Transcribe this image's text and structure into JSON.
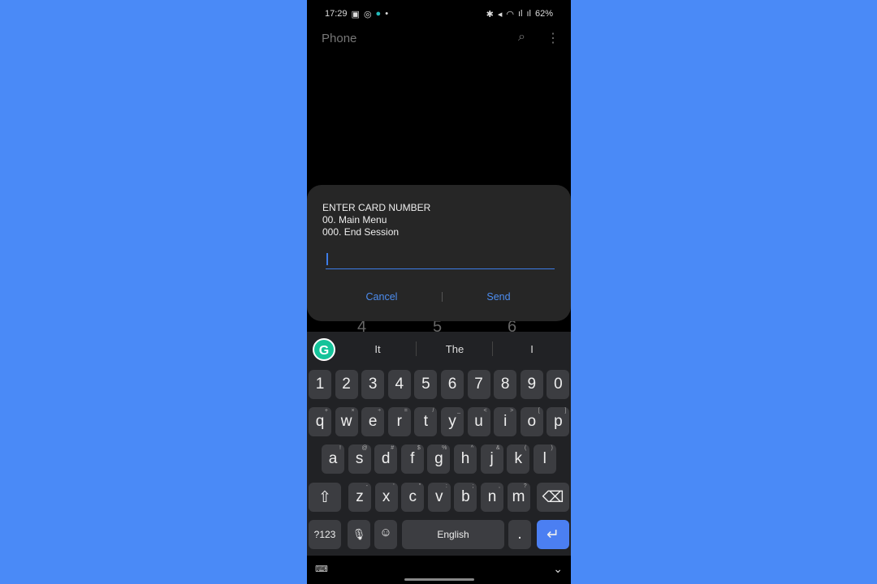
{
  "status": {
    "time": "17:29",
    "battery": "62%"
  },
  "app": {
    "title": "Phone"
  },
  "dialog": {
    "message": "ENTER CARD NUMBER\n00. Main Menu\n000. End Session",
    "input_value": "",
    "cancel": "Cancel",
    "send": "Send"
  },
  "dialpad_behind": [
    "4",
    "5",
    "6"
  ],
  "keyboard": {
    "suggestions": [
      "It",
      "The",
      "I"
    ],
    "numbers": [
      "1",
      "2",
      "3",
      "4",
      "5",
      "6",
      "7",
      "8",
      "9",
      "0"
    ],
    "row1": [
      [
        "q",
        "+"
      ],
      [
        "w",
        "×"
      ],
      [
        "e",
        "÷"
      ],
      [
        "r",
        "="
      ],
      [
        "t",
        "/"
      ],
      [
        "y",
        "_"
      ],
      [
        "u",
        "<"
      ],
      [
        "i",
        ">"
      ],
      [
        "o",
        "["
      ],
      [
        "p",
        "]"
      ]
    ],
    "row2": [
      [
        "a",
        "!"
      ],
      [
        "s",
        "@"
      ],
      [
        "d",
        "#"
      ],
      [
        "f",
        "$"
      ],
      [
        "g",
        "%"
      ],
      [
        "h",
        "^"
      ],
      [
        "j",
        "&"
      ],
      [
        "k",
        "("
      ],
      [
        "l",
        ")"
      ]
    ],
    "row3": [
      [
        "z",
        "-"
      ],
      [
        "x",
        "'"
      ],
      [
        "c",
        "\""
      ],
      [
        "v",
        ":"
      ],
      [
        "b",
        ";"
      ],
      [
        "n",
        ","
      ],
      [
        "m",
        "?"
      ]
    ],
    "symbols": "?123",
    "space": "English",
    "period": ".",
    "accent": "#4b7ff2"
  }
}
